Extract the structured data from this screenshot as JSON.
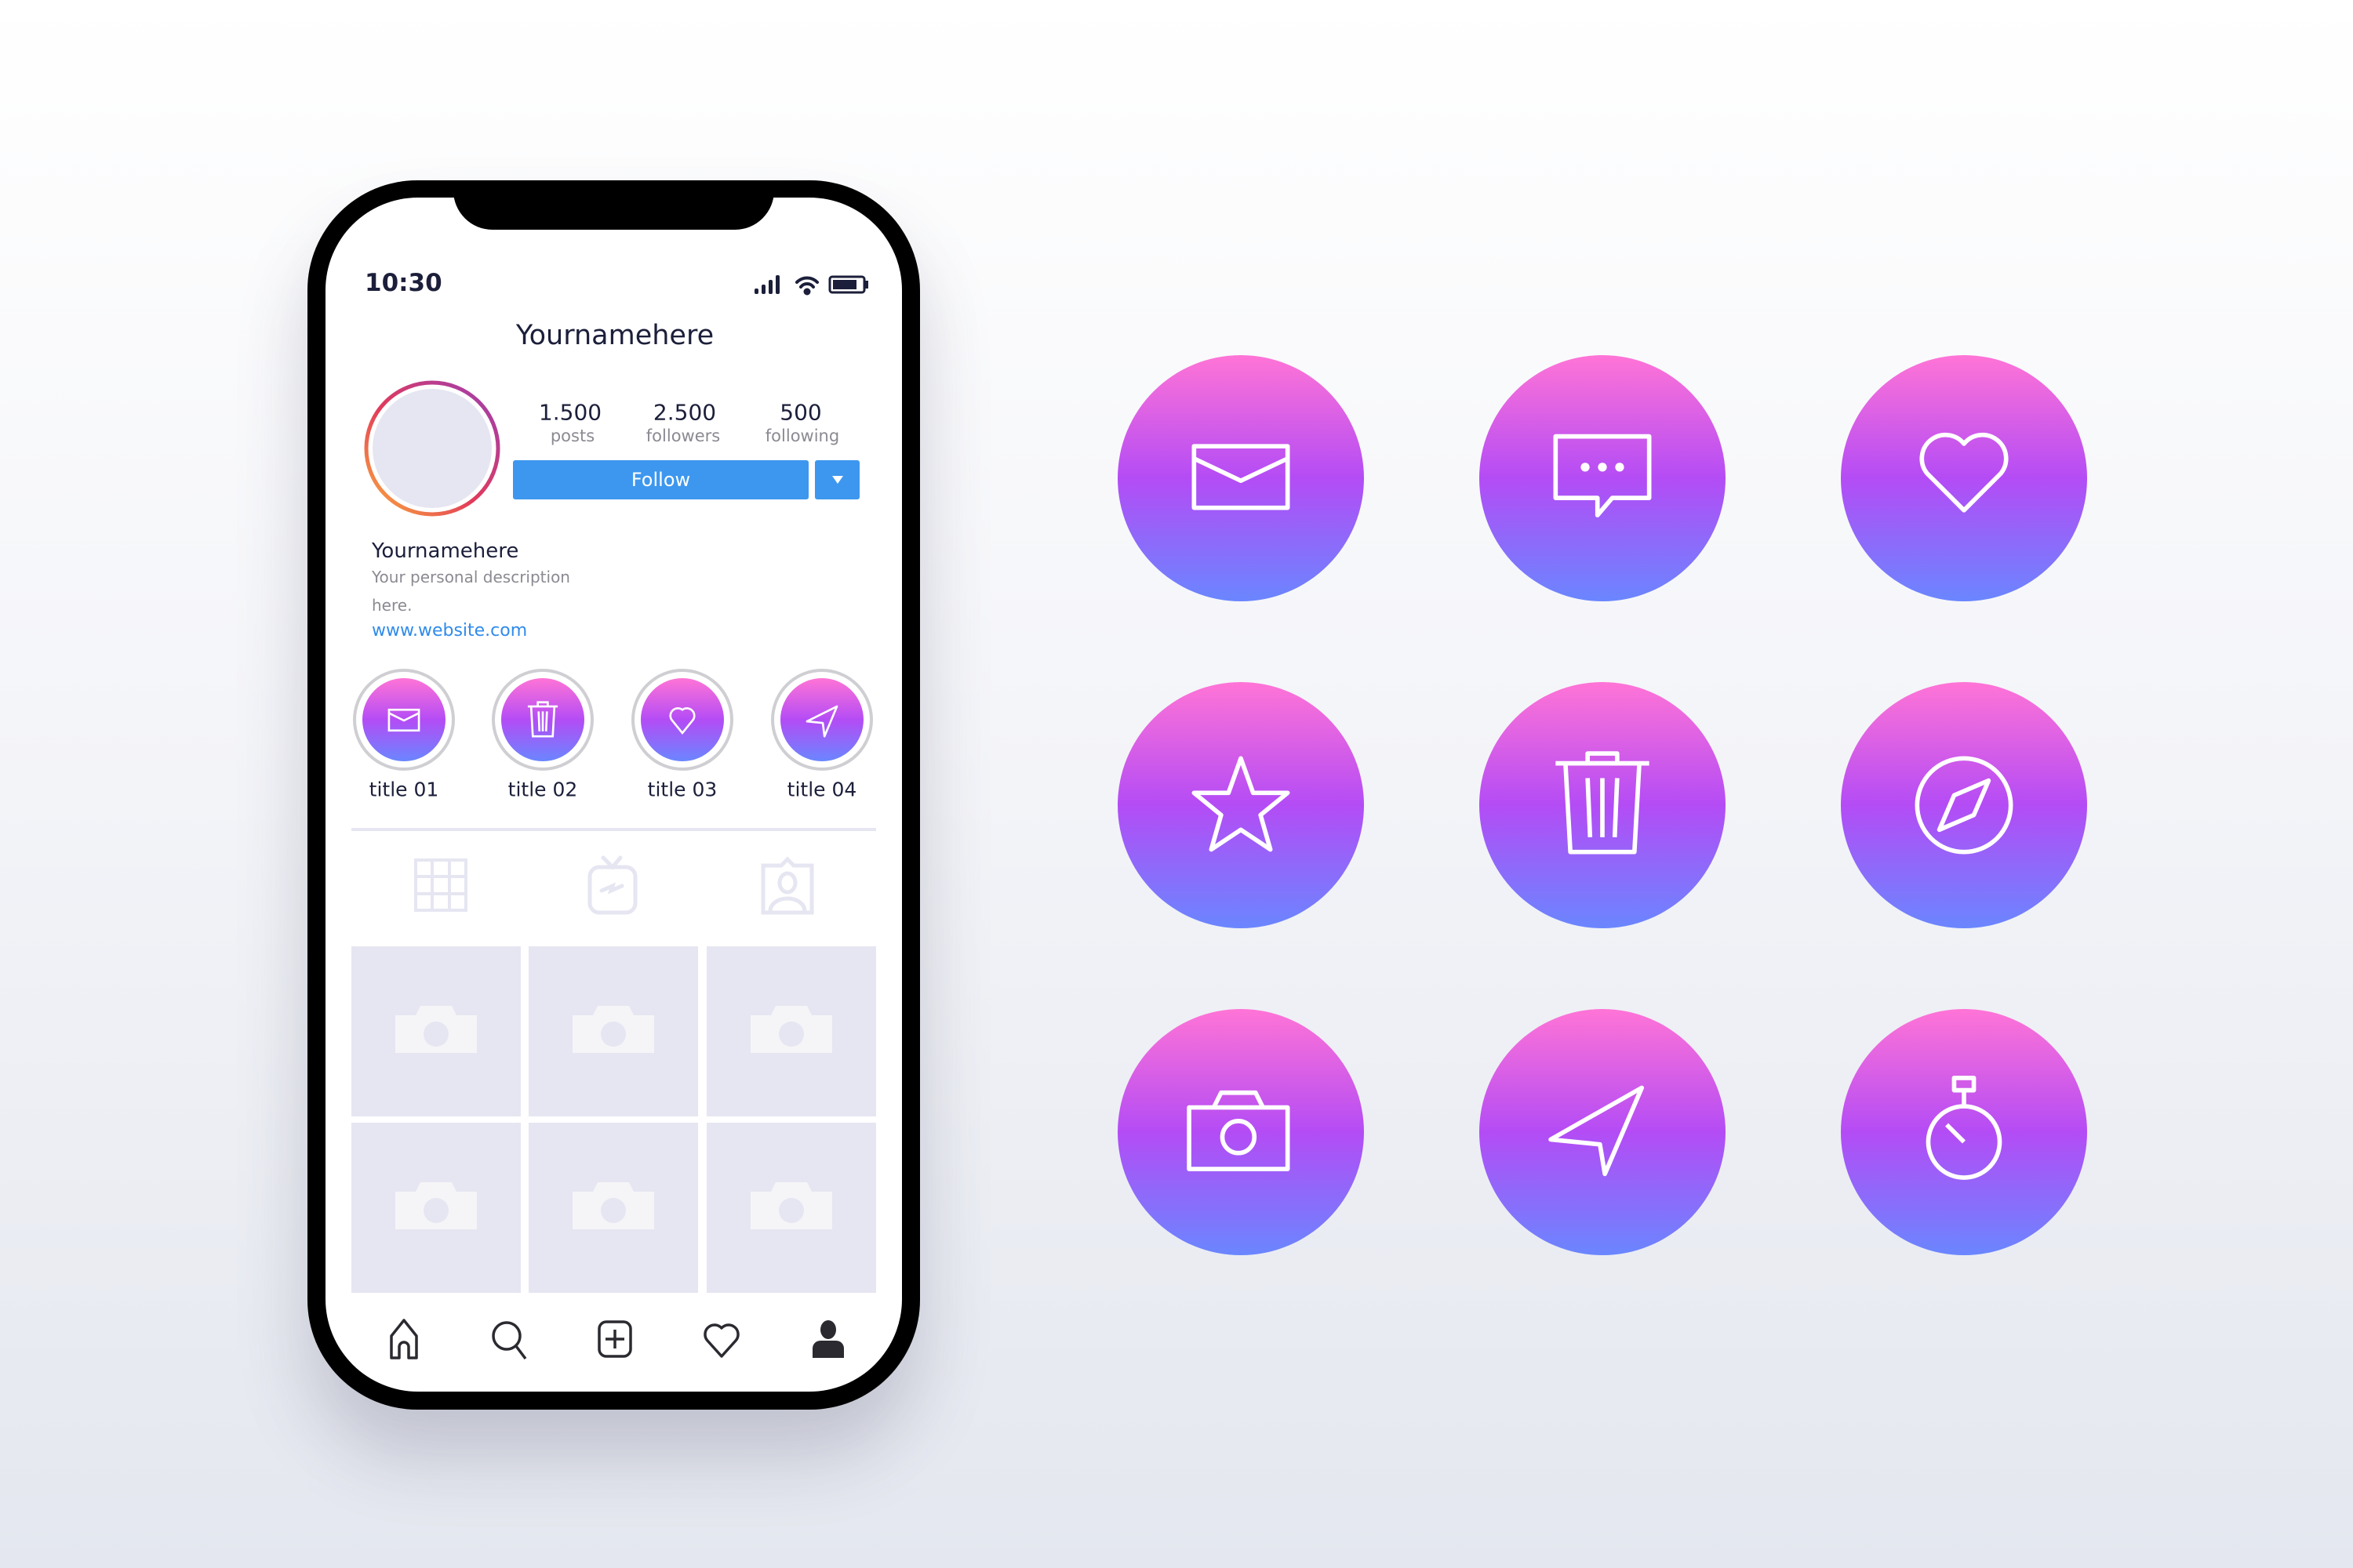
{
  "status_bar": {
    "time": "10:30",
    "icons": [
      "signal-icon",
      "wifi-icon",
      "battery-icon"
    ]
  },
  "profile": {
    "header_title": "Yournamehere",
    "stats": [
      {
        "value": "1.500",
        "label": "posts"
      },
      {
        "value": "2.500",
        "label": "followers"
      },
      {
        "value": "500",
        "label": "following"
      }
    ],
    "follow_label": "Follow",
    "name": "Yournamehere",
    "description_line1": "Your personal description",
    "description_line2": "here.",
    "website": "www.website.com"
  },
  "highlights": [
    {
      "title": "title 01",
      "icon": "mail-icon"
    },
    {
      "title": "title 02",
      "icon": "trash-icon"
    },
    {
      "title": "title 03",
      "icon": "heart-icon"
    },
    {
      "title": "title 04",
      "icon": "send-icon"
    }
  ],
  "content_tabs": [
    "grid-icon",
    "igtv-icon",
    "tagged-icon"
  ],
  "bottom_nav": [
    "home-icon",
    "search-icon",
    "add-icon",
    "heart-icon",
    "profile-icon"
  ],
  "icon_set": [
    "mail-icon",
    "chat-icon",
    "heart-icon",
    "star-icon",
    "trash-icon",
    "compass-icon",
    "camera-icon",
    "send-icon",
    "timer-icon"
  ],
  "colors": {
    "gradient_top": "#ff74d6",
    "gradient_mid": "#b44cf5",
    "gradient_bottom": "#6a86ff",
    "follow_button": "#3d97ee",
    "link": "#2f8bea"
  }
}
